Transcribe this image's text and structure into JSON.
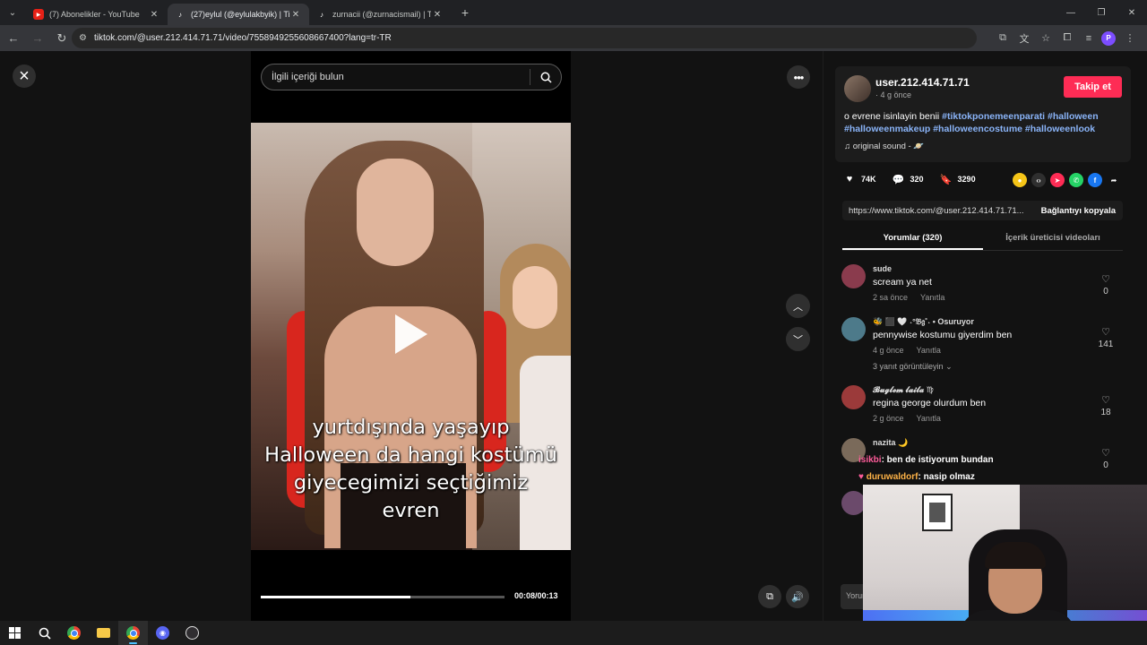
{
  "browser": {
    "tabs": [
      {
        "title": "(7) Abonelikler - YouTube",
        "favicon": "youtube-icon",
        "active": false
      },
      {
        "title": "(27)eylul (@eylulakbyik) | TikTok",
        "favicon": "tiktok-icon",
        "active": true
      },
      {
        "title": "zurnacii (@zurnacismail) | TikTok",
        "favicon": "tiktok-icon",
        "active": false
      }
    ],
    "url": "tiktok.com/@user.212.414.71.71/video/7558949255608667400?lang=tr-TR",
    "profile_initial": "P"
  },
  "viewer": {
    "search_placeholder": "İlgili içeriği bulun",
    "caption_lines": [
      "yurtdışında yaşayıp",
      "Halloween da hangi kostümü",
      "giyecegimizi seçtiğimiz",
      "evren"
    ],
    "time": "00:08/00:13",
    "progress": 0.615
  },
  "post": {
    "username": "user.212.414.71.71",
    "meta": "· 4 g önce",
    "follow_label": "Takip et",
    "description_text": "o evrene isinlayin benii ",
    "hashtags": [
      "#tiktokponemeenparati",
      "#halloween",
      "#halloweenmakeup",
      "#halloweencostume",
      "#halloweenlook"
    ],
    "sound": "original sound - ",
    "likes": "74K",
    "comments_count": "320",
    "saves": "3290",
    "link": "https://www.tiktok.com/@user.212.414.71.71...",
    "copy_label": "Bağlantıyı kopyala",
    "tab_comments": "Yorumlar (320)",
    "tab_creator": "İçerik üreticisi videoları"
  },
  "comments": [
    {
      "user": "sude",
      "text": "scream ya net",
      "time": "2 sa önce",
      "reply": "Yanıtla",
      "likes": "0",
      "avatar_color": "#8a3b4d"
    },
    {
      "user": "🐝 ⬛ 🤍 ˖°𝔅𝔤˚˖ • Osuruyor",
      "text": "pennywise kostumu giyerdim ben",
      "time": "4 g önce",
      "reply": "Yanıtla",
      "likes": "141",
      "more": "3 yanıt görüntüleyin",
      "avatar_color": "#4d7a8a"
    },
    {
      "user": "𝓑𝓾𝓰𝓵𝓮𝓶 𝓵𝓪𝓲𝓵𝓪 ♍",
      "text": "regina george olurdum ben",
      "time": "2 g önce",
      "reply": "Yanıtla",
      "likes": "18",
      "avatar_color": "#9b3a3a"
    },
    {
      "user": "nazita 🌙",
      "text": "",
      "time": "",
      "reply": "",
      "likes": "0",
      "avatar_color": "#7a6a5a"
    }
  ],
  "stream_chat": [
    {
      "name": "isikbi",
      "text": ": ben de istiyorum bundan"
    },
    {
      "name": "duruwaldorf",
      "text": ": nasip olmaz"
    }
  ],
  "comment_input_placeholder": "Yorum"
}
